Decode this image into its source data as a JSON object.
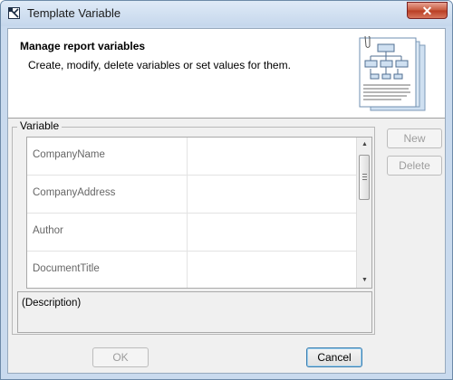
{
  "window": {
    "title": "Template Variable",
    "close_glyph": "✕"
  },
  "header": {
    "title": "Manage report variables",
    "description": "Create, modify, delete variables or set values for them."
  },
  "variables": {
    "group_label": "Variable",
    "rows": [
      {
        "name": "CompanyName",
        "value": ""
      },
      {
        "name": "CompanyAddress",
        "value": ""
      },
      {
        "name": "Author",
        "value": ""
      },
      {
        "name": "DocumentTitle",
        "value": ""
      }
    ],
    "description_placeholder": "(Description)"
  },
  "side_buttons": {
    "new_label": "New",
    "delete_label": "Delete"
  },
  "footer": {
    "ok_label": "OK",
    "cancel_label": "Cancel"
  },
  "icons": {
    "app": "diagram-icon",
    "header": "report-template-icon",
    "scroll_up": "scroll-up-arrow-icon",
    "scroll_down": "scroll-down-arrow-icon"
  },
  "colors": {
    "titlebar": "#c9daee",
    "close": "#c75a3f",
    "default_focus": "#3c7fb1"
  }
}
